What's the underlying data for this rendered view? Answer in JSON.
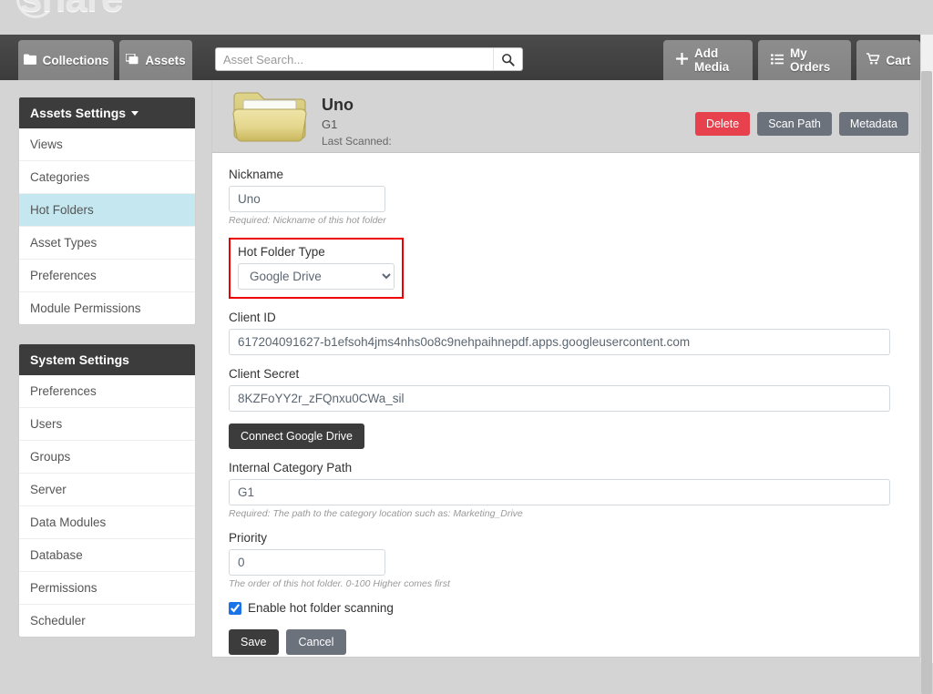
{
  "brand": {
    "wordmark": "share"
  },
  "navbar": {
    "tabs": [
      {
        "label": "Collections",
        "icon": "folder-icon"
      },
      {
        "label": "Assets",
        "icon": "images-icon"
      }
    ],
    "search": {
      "placeholder": "Asset Search...",
      "value": "",
      "icon": "search-icon"
    },
    "actions": [
      {
        "label": "Add Media",
        "icon": "plus-icon"
      },
      {
        "label": "My Orders",
        "icon": "list-icon"
      },
      {
        "label": "Cart",
        "icon": "cart-icon"
      }
    ]
  },
  "sidebar": {
    "assets_settings": {
      "title": "Assets Settings",
      "has_caret": true,
      "items": [
        {
          "label": "Views",
          "active": false
        },
        {
          "label": "Categories",
          "active": false
        },
        {
          "label": "Hot Folders",
          "active": true
        },
        {
          "label": "Asset Types",
          "active": false
        },
        {
          "label": "Preferences",
          "active": false
        },
        {
          "label": "Module Permissions",
          "active": false
        }
      ]
    },
    "system_settings": {
      "title": "System Settings",
      "items": [
        {
          "label": "Preferences"
        },
        {
          "label": "Users"
        },
        {
          "label": "Groups"
        },
        {
          "label": "Server"
        },
        {
          "label": "Data Modules"
        },
        {
          "label": "Database"
        },
        {
          "label": "Permissions"
        },
        {
          "label": "Scheduler"
        }
      ]
    }
  },
  "content_header": {
    "icon": "folder-icon",
    "title": "Uno",
    "subtitle": "G1",
    "last_scanned": "Last Scanned:",
    "buttons": [
      {
        "label": "Delete",
        "style": "danger",
        "color": "#e8414e"
      },
      {
        "label": "Scan Path",
        "style": "muted",
        "color": "#6b727c"
      },
      {
        "label": "Metadata",
        "style": "muted",
        "color": "#6b727c"
      }
    ]
  },
  "form": {
    "nickname": {
      "label": "Nickname",
      "value": "Uno",
      "hint": "Required: Nickname of this hot folder"
    },
    "hot_folder_type": {
      "label": "Hot Folder Type",
      "value": "Google Drive",
      "options": [
        "Google Drive"
      ],
      "highlight_color": "#ee0000"
    },
    "client_id": {
      "label": "Client ID",
      "value": "617204091627-b1efsoh4jms4nhs0o8c9nehpaihnepdf.apps.googleusercontent.com"
    },
    "client_secret": {
      "label": "Client Secret",
      "value": "8KZFoYY2r_zFQnxu0CWa_sil"
    },
    "connect_button": {
      "label": "Connect Google Drive"
    },
    "internal_category_path": {
      "label": "Internal Category Path",
      "value": "G1",
      "hint": "Required: The path to the category location such as: Marketing_Drive"
    },
    "priority": {
      "label": "Priority",
      "value": "0",
      "hint": "The order of this hot folder. 0-100 Higher comes first"
    },
    "enable_scanning": {
      "label": "Enable hot folder scanning",
      "checked": true
    },
    "save_button": {
      "label": "Save"
    },
    "cancel_button": {
      "label": "Cancel"
    }
  }
}
